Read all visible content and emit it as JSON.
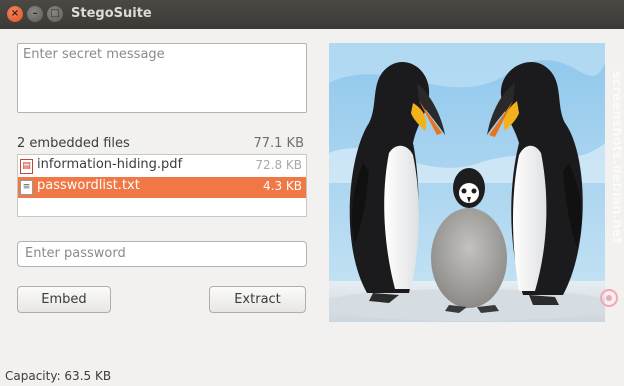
{
  "window": {
    "title": "StegoSuite",
    "close_glyph": "×",
    "minimize_glyph": "–",
    "maximize_glyph": "□"
  },
  "message": {
    "placeholder": "Enter secret message"
  },
  "files": {
    "count_label": "2 embedded files",
    "total_size": "77.1 KB",
    "items": [
      {
        "name": "information-hiding.pdf",
        "size": "72.8 KB",
        "icon": "pdf-file-icon",
        "selected": false
      },
      {
        "name": "passwordlist.txt",
        "size": "4.3 KB",
        "icon": "text-file-icon",
        "selected": true
      }
    ]
  },
  "password": {
    "placeholder": "Enter password"
  },
  "buttons": {
    "embed": "Embed",
    "extract": "Extract"
  },
  "status": {
    "capacity": "Capacity: 63.5 KB"
  },
  "cover_image": {
    "description_icon": "penguins-cover-image",
    "watermark": "screenshots.debian.net"
  },
  "colors": {
    "selection": "#f07746",
    "titlebar": "#3b3a36",
    "close_button": "#e0501f"
  }
}
